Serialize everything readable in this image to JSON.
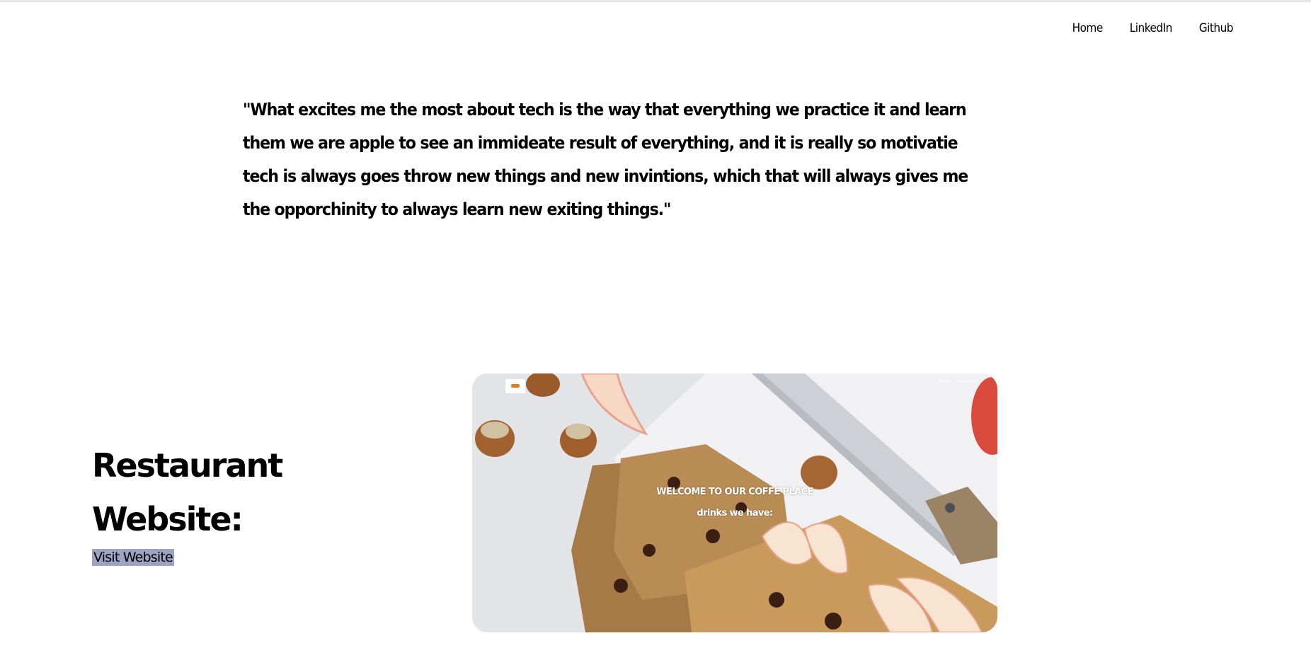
{
  "nav": {
    "items": [
      "Home",
      "LinkedIn",
      "Github"
    ]
  },
  "quote": {
    "text": "\"What excites me the most about tech is the way that everything we practice it and learn them we are apple to see an immideate result of everything, and it is really so motivatie tech is always goes throw new things and new invintions, which that will always gives me the opporchinity to always learn new exiting things.\""
  },
  "project": {
    "title": "Restaurant Website:",
    "link_label": "Visit Website",
    "preview": {
      "nav_items": [
        "Home",
        "Contact Us"
      ],
      "heading": "WELCOME TO OUR COFFE PLACE",
      "subheading": "drinks we have:"
    }
  },
  "colors": {
    "link_highlight": "#9ea3c3",
    "preview_logo_accent": "#e3791f"
  }
}
